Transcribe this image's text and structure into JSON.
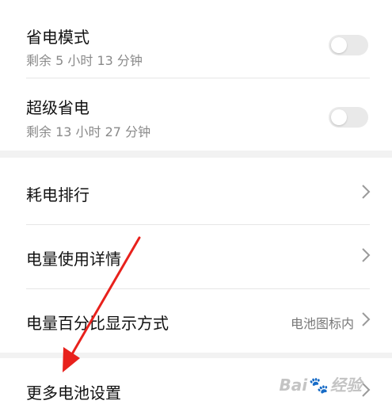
{
  "power_saving": {
    "title": "省电模式",
    "subtitle": "剩余 5 小时 13 分钟",
    "enabled": false
  },
  "super_saving": {
    "title": "超级省电",
    "subtitle": "剩余 13 小时 27 分钟",
    "enabled": false
  },
  "menu": {
    "consumption_ranking": "耗电排行",
    "usage_details": "电量使用详情",
    "percentage_display": "电量百分比显示方式",
    "percentage_display_value": "电池图标内",
    "more_battery_settings": "更多电池设置"
  },
  "icons": {
    "chevron": "chevron-right-icon",
    "toggle": "toggle-switch",
    "annotation": "red-arrow-annotation"
  },
  "watermark": {
    "text_left": "Bai",
    "text_right": "经验"
  },
  "colors": {
    "arrow": "#e8211c",
    "toggle_off": "#e9e9e9",
    "text_primary": "#111111",
    "text_secondary": "#8a8a8a"
  }
}
